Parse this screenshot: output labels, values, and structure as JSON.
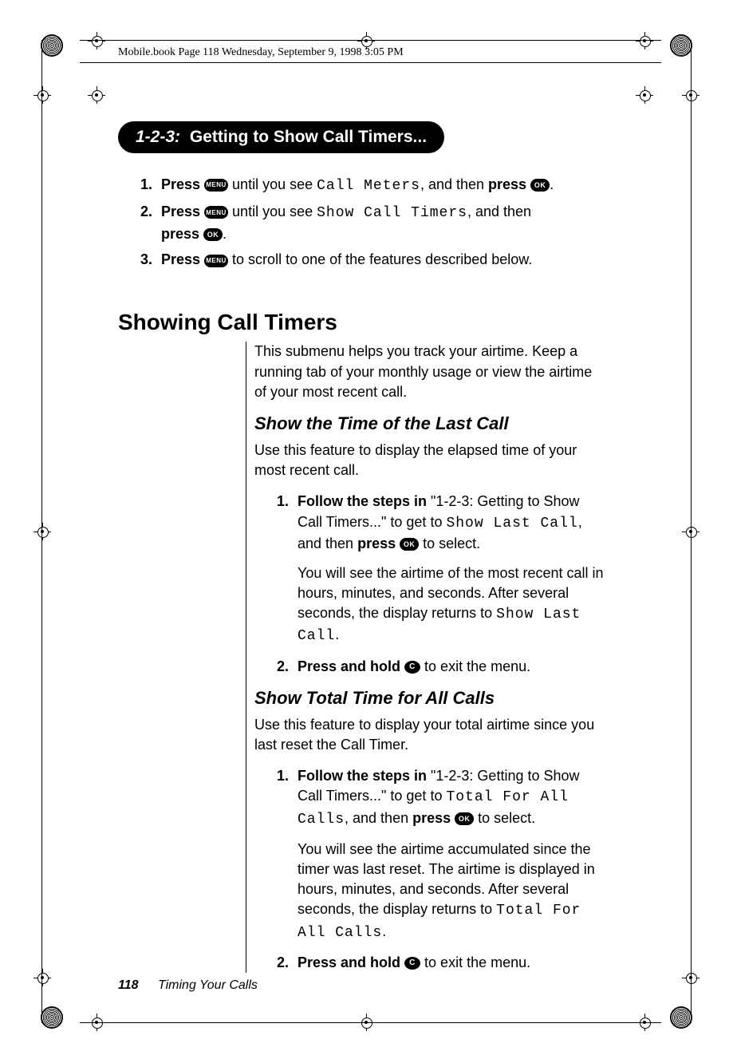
{
  "meta_header": "Mobile.book  Page 118  Wednesday, September 9, 1998  3:05 PM",
  "pill": {
    "num": "1-2-3:",
    "title": "Getting to Show Call Timers..."
  },
  "main_steps": [
    {
      "n": "1.",
      "lead1": "Press ",
      "btn1": "MENU",
      "mid1": " until you see ",
      "mono1": "Call Meters",
      "mid2": ", and then ",
      "lead2": "press ",
      "btn2": "OK",
      "tail": "."
    },
    {
      "n": "2.",
      "lead1": "Press ",
      "btn1": "MENU",
      "mid1": " until you see ",
      "mono1": "Show Call Timers",
      "mid2": ", and then ",
      "lead2": "press ",
      "btn2": "OK",
      "tail": "."
    },
    {
      "n": "3.",
      "lead1": "Press ",
      "btn1": "MENU",
      "mid1": " to scroll to one of the features described below."
    }
  ],
  "section_title": "Showing Call Timers",
  "intro": "This submenu helps you track your airtime. Keep a running tab of your monthly usage or view the airtime of your most recent call.",
  "sub1": {
    "title": "Show the Time of the Last Call",
    "lead": "Use this feature to display the elapsed time of your most recent call.",
    "step1": {
      "n": "1.",
      "bold1": "Follow the steps in ",
      "quote": "\"1-2-3: Getting to Show Call Timers...\" to get to ",
      "mono": "Show Last Call",
      "mid": ", and then ",
      "bold2": "press ",
      "btn": "OK",
      "tail": " to select."
    },
    "note": {
      "pre": "You will see the airtime of the most recent call in hours, minutes, and seconds. After several seconds, the display returns to ",
      "mono": "Show Last Call",
      "post": "."
    },
    "step2": {
      "n": "2.",
      "bold": "Press and hold ",
      "btn": "C",
      "tail": " to exit the menu."
    }
  },
  "sub2": {
    "title": "Show Total Time for All Calls",
    "lead": "Use this feature to display your total airtime since you last reset the Call Timer.",
    "step1": {
      "n": "1.",
      "bold1": "Follow the steps in ",
      "quote": "\"1-2-3: Getting to Show Call Timers...\" to get to ",
      "mono": "Total For All Calls",
      "mid": ", and then ",
      "bold2": "press ",
      "btn": "OK",
      "tail": " to select."
    },
    "note": {
      "pre": "You will see the airtime accumulated since the timer was last reset. The airtime is displayed in hours, minutes, and seconds. After several seconds, the display returns to ",
      "mono": "Total For All Calls",
      "post": "."
    },
    "step2": {
      "n": "2.",
      "bold": "Press and hold ",
      "btn": "C",
      "tail": " to exit the menu."
    }
  },
  "footer": {
    "page": "118",
    "title": "Timing Your Calls"
  }
}
